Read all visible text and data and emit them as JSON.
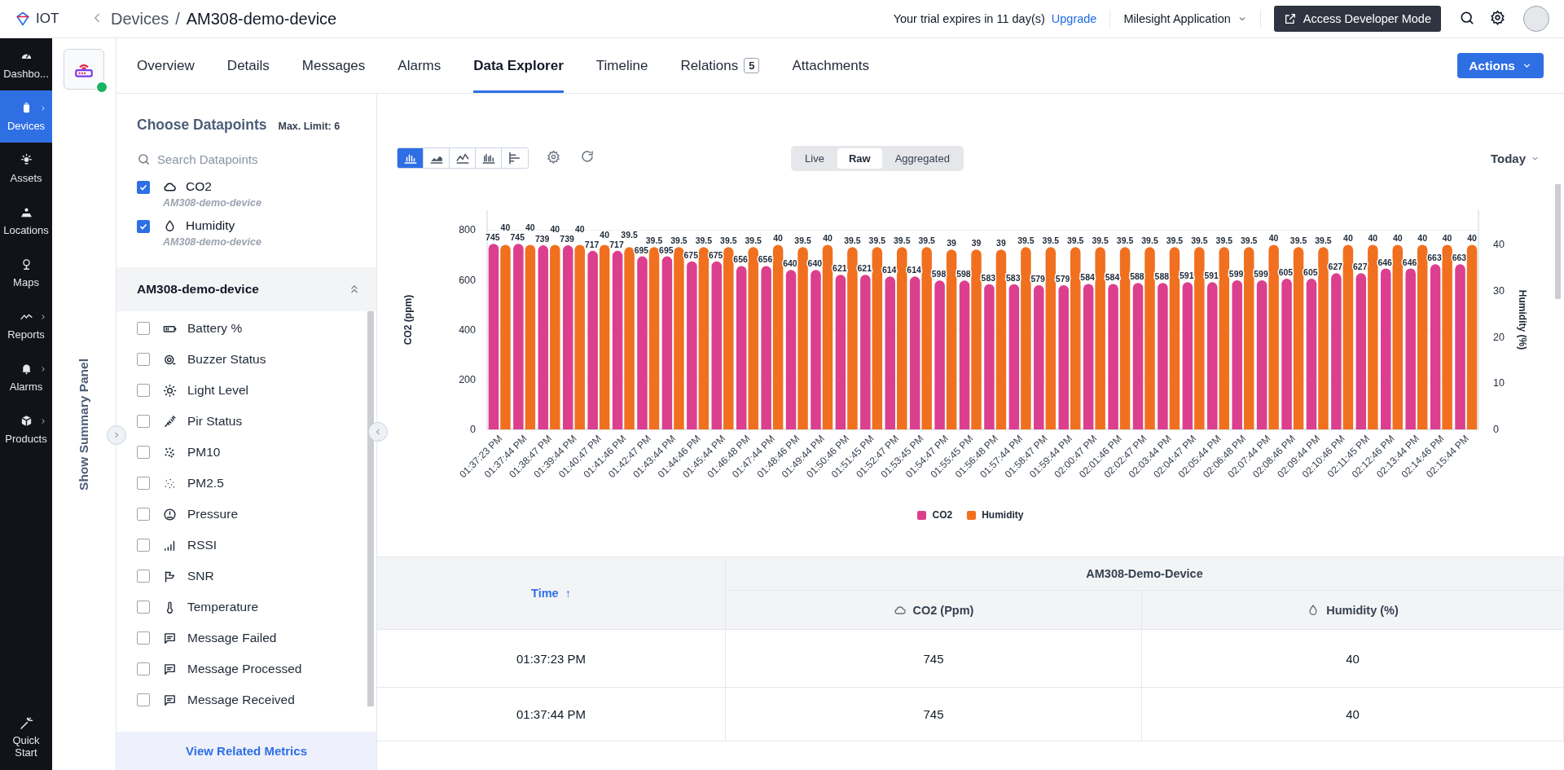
{
  "header": {
    "app_name": "IOT",
    "breadcrumb_parent": "Devices",
    "separator": "/",
    "breadcrumb_current": "AM308-demo-device",
    "trial_text": "Your trial expires in 11 day(s)",
    "upgrade_link": "Upgrade",
    "application": "Milesight Application",
    "developer_button": "Access Developer Mode"
  },
  "nav": [
    {
      "label": "Dashbo...",
      "selected": false,
      "has_submenu": false
    },
    {
      "label": "Devices",
      "selected": true,
      "has_submenu": true
    },
    {
      "label": "Assets",
      "selected": false,
      "has_submenu": false
    },
    {
      "label": "Locations",
      "selected": false,
      "has_submenu": false
    },
    {
      "label": "Maps",
      "selected": false,
      "has_submenu": false
    },
    {
      "label": "Reports",
      "selected": false,
      "has_submenu": true
    },
    {
      "label": "Alarms",
      "selected": false,
      "has_submenu": true
    },
    {
      "label": "Products",
      "selected": false,
      "has_submenu": true
    }
  ],
  "quick_start": "Quick Start",
  "device": {
    "online": true,
    "summary_toggle": "Show Summary Panel"
  },
  "tabs": [
    {
      "label": "Overview",
      "selected": false
    },
    {
      "label": "Details",
      "selected": false
    },
    {
      "label": "Messages",
      "selected": false
    },
    {
      "label": "Alarms",
      "selected": false
    },
    {
      "label": "Data Explorer",
      "selected": true
    },
    {
      "label": "Timeline",
      "selected": false
    },
    {
      "label": "Relations",
      "selected": false,
      "count": "5"
    },
    {
      "label": "Attachments",
      "selected": false
    }
  ],
  "actions_button": "Actions",
  "datapoints": {
    "title": "Choose Datapoints",
    "limit": "Max. Limit: 6",
    "search_placeholder": "Search Datapoints",
    "chosen": [
      {
        "label": "CO2",
        "device": "AM308-demo-device",
        "checked": true
      },
      {
        "label": "Humidity",
        "device": "AM308-demo-device",
        "checked": true
      }
    ],
    "group": {
      "title": "AM308-demo-device",
      "expanded": true,
      "items": [
        {
          "label": "Battery %",
          "checked": false
        },
        {
          "label": "Buzzer Status",
          "checked": false
        },
        {
          "label": "Light Level",
          "checked": false
        },
        {
          "label": "Pir Status",
          "checked": false
        },
        {
          "label": "PM10",
          "checked": false
        },
        {
          "label": "PM2.5",
          "checked": false
        },
        {
          "label": "Pressure",
          "checked": false
        },
        {
          "label": "RSSI",
          "checked": false
        },
        {
          "label": "SNR",
          "checked": false
        },
        {
          "label": "Temperature",
          "checked": false
        },
        {
          "label": "Message Failed",
          "checked": false
        },
        {
          "label": "Message Processed",
          "checked": false
        },
        {
          "label": "Message Received",
          "checked": false
        }
      ]
    },
    "footer_link": "View Related Metrics"
  },
  "chart_toolbar": {
    "chart_types": [
      {
        "kind": "bar",
        "selected": true
      },
      {
        "kind": "area",
        "selected": false
      },
      {
        "kind": "line",
        "selected": false
      },
      {
        "kind": "grouped",
        "selected": false
      },
      {
        "kind": "horizontal",
        "selected": false
      }
    ],
    "modes": [
      {
        "label": "Live",
        "selected": false
      },
      {
        "label": "Raw",
        "selected": true
      },
      {
        "label": "Aggregated",
        "selected": false
      }
    ],
    "range": "Today"
  },
  "chart": {
    "chart_data": {
      "type": "bar",
      "stacked": false,
      "grid": true,
      "ylabel": "CO2 (ppm)",
      "y2label": "Humidity (%)",
      "ylim": [
        0,
        880
      ],
      "y2lim": [
        0,
        47.5
      ],
      "yticks": [
        0,
        200,
        400,
        600,
        800
      ],
      "y2ticks": [
        0,
        10,
        20,
        30,
        40
      ],
      "data_labels": true,
      "categories": [
        "01:37:23 PM",
        "01:37:44 PM",
        "01:38:47 PM",
        "01:39:44 PM",
        "01:40:47 PM",
        "01:41:46 PM",
        "01:42:47 PM",
        "01:43:44 PM",
        "01:44:46 PM",
        "01:45:44 PM",
        "01:46:48 PM",
        "01:47:44 PM",
        "01:48:46 PM",
        "01:49:44 PM",
        "01:50:46 PM",
        "01:51:45 PM",
        "01:52:47 PM",
        "01:53:45 PM",
        "01:54:47 PM",
        "01:55:45 PM",
        "01:56:48 PM",
        "01:57:44 PM",
        "01:58:47 PM",
        "01:59:44 PM",
        "02:00:47 PM",
        "02:01:46 PM",
        "02:02:47 PM",
        "02:03:44 PM",
        "02:04:47 PM",
        "02:05:44 PM",
        "02:06:48 PM",
        "02:07:44 PM",
        "02:08:46 PM",
        "02:09:44 PM",
        "02:10:46 PM",
        "02:11:45 PM",
        "02:12:46 PM",
        "02:13:44 PM",
        "02:14:46 PM",
        "02:15:44 PM"
      ],
      "series": [
        {
          "name": "CO2",
          "color": "#db3f8e",
          "values": [
            745,
            745,
            739,
            739,
            717,
            717,
            695,
            695,
            675,
            675,
            656,
            656,
            640,
            640,
            621,
            621,
            614,
            614,
            598,
            598,
            583,
            583,
            579,
            579,
            584,
            584,
            588,
            588,
            591,
            591,
            599,
            599,
            605,
            605,
            627,
            627,
            646,
            646,
            663,
            663
          ]
        },
        {
          "name": "Humidity",
          "color": "#f07020",
          "axis": "y2",
          "values": [
            40,
            40,
            40,
            40,
            40,
            39.5,
            39.5,
            39.5,
            39.5,
            39.5,
            39.5,
            40,
            39.5,
            40,
            39.5,
            39.5,
            39.5,
            39.5,
            39,
            39,
            39,
            39.5,
            39.5,
            39.5,
            39.5,
            39.5,
            39.5,
            39.5,
            39.5,
            39.5,
            39.5,
            40,
            39.5,
            39.5,
            40,
            40,
            40,
            40,
            40,
            40
          ]
        }
      ]
    }
  },
  "table": {
    "sort_icon": "↑",
    "group_header": "AM308-Demo-Device",
    "columns": [
      "Time",
      "CO2 (Ppm)",
      "Humidity (%)"
    ],
    "rows": [
      [
        "01:37:23 PM",
        "745",
        "40"
      ],
      [
        "01:37:44 PM",
        "745",
        "40"
      ]
    ]
  }
}
